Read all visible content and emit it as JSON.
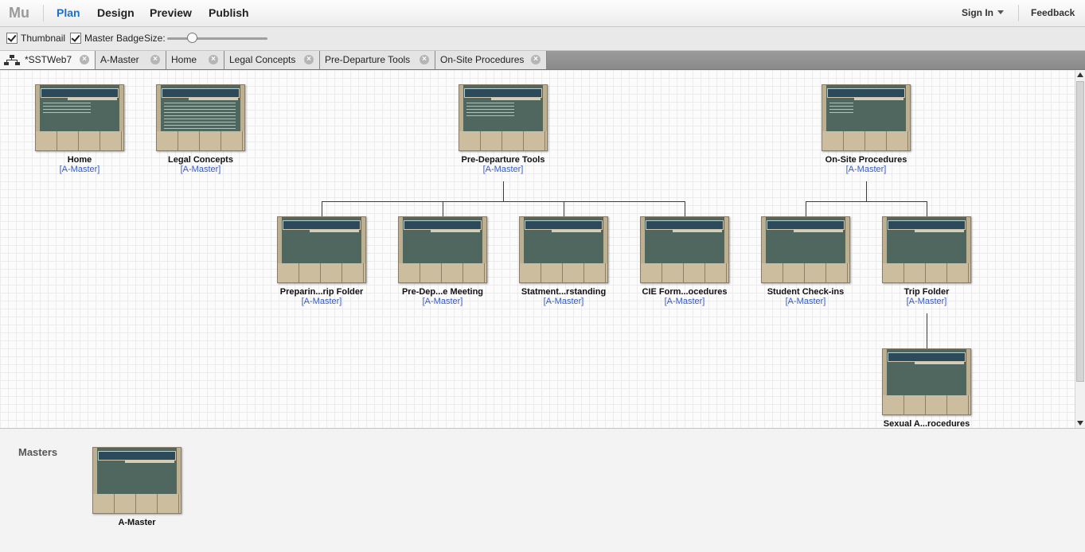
{
  "app": {
    "logo": "Mu",
    "modes": [
      "Plan",
      "Design",
      "Preview",
      "Publish"
    ],
    "active_mode": "Plan",
    "sign_in": "Sign In",
    "feedback": "Feedback"
  },
  "options": {
    "thumbnail_label": "Thumbnail",
    "master_badge_label": "Master Badge",
    "size_label": "Size:",
    "thumbnail_checked": true,
    "master_badge_checked": true
  },
  "tabs": [
    {
      "label": "*SSTWeb7",
      "active": true
    },
    {
      "label": "A-Master",
      "active": false
    },
    {
      "label": "Home",
      "active": false
    },
    {
      "label": "Legal Concepts",
      "active": false
    },
    {
      "label": "Pre-Departure Tools",
      "active": false
    },
    {
      "label": "On-Site Procedures",
      "active": false
    }
  ],
  "sitemap": {
    "pages": [
      {
        "name": "Home",
        "master": "[A-Master]"
      },
      {
        "name": "Legal Concepts",
        "master": "[A-Master]"
      },
      {
        "name": "Pre-Departure Tools",
        "master": "[A-Master]"
      },
      {
        "name": "On-Site Procedures",
        "master": "[A-Master]"
      },
      {
        "name": "Preparin...rip Folder",
        "master": "[A-Master]"
      },
      {
        "name": "Pre-Dep...e Meeting",
        "master": "[A-Master]"
      },
      {
        "name": "Statment...rstanding",
        "master": "[A-Master]"
      },
      {
        "name": "CIE Form...ocedures",
        "master": "[A-Master]"
      },
      {
        "name": "Student Check-ins",
        "master": "[A-Master]"
      },
      {
        "name": "Trip Folder",
        "master": "[A-Master]"
      },
      {
        "name": "Sexual A...rocedures",
        "master": ""
      }
    ]
  },
  "masters_panel": {
    "label": "Masters",
    "items": [
      {
        "name": "A-Master"
      }
    ]
  },
  "colors": {
    "accent": "#1f6fc8",
    "master_link": "#3359c6",
    "thumbnail_body": "#4f675f"
  }
}
